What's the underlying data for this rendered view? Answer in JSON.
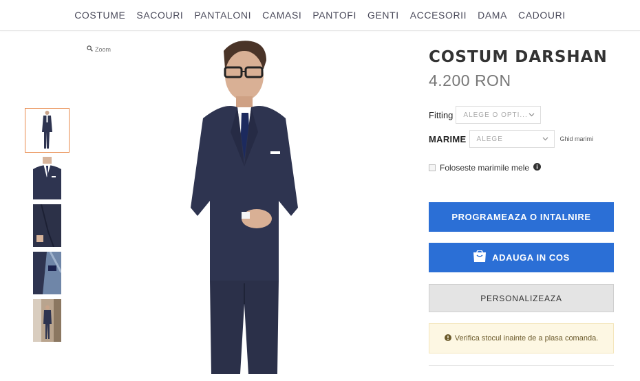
{
  "nav": {
    "items": [
      "COSTUME",
      "SACOURI",
      "PANTALONI",
      "CAMASI",
      "PANTOFI",
      "GENTI",
      "ACCESORII",
      "DAMA",
      "CADOURI"
    ]
  },
  "gallery": {
    "zoom_label": "Zoom"
  },
  "product": {
    "title": "COSTUM DARSHAN",
    "price": "4.200 RON",
    "fitting_label": "Fitting",
    "fitting_placeholder": "ALEGE O OPTI...",
    "size_label": "MARIME",
    "size_placeholder": "ALEGE",
    "size_guide": "Ghid marimi",
    "use_my_sizes": "Foloseste marimile mele"
  },
  "actions": {
    "appointment": "PROGRAMEAZA O INTALNIRE",
    "add_to_cart": "ADAUGA IN COS",
    "customize": "PERSONALIZEAZA"
  },
  "notice": {
    "text": "Verifica stocul inainte de a plasa comanda."
  },
  "colors": {
    "primary": "#2b6fd6",
    "thumb_active_border": "#e8894a",
    "suit": "#2e3450",
    "notice_bg": "#fdf7e3"
  }
}
